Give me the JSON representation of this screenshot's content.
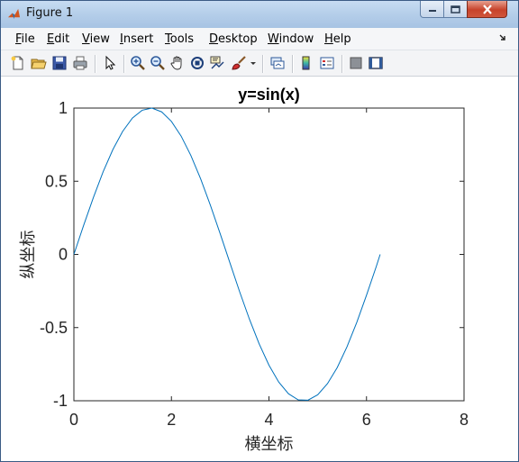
{
  "window": {
    "title": "Figure 1"
  },
  "menu": {
    "file": {
      "u": "F",
      "rest": "ile"
    },
    "edit": {
      "u": "E",
      "rest": "dit"
    },
    "view": {
      "u": "V",
      "rest": "iew"
    },
    "insert": {
      "u": "I",
      "rest": "nsert"
    },
    "tools": {
      "u": "T",
      "rest": "ools"
    },
    "desktop": {
      "u": "D",
      "rest": "esktop"
    },
    "window": {
      "u": "W",
      "rest": "indow"
    },
    "help": {
      "u": "H",
      "rest": "elp"
    }
  },
  "toolbar_icons": [
    "new-figure-icon",
    "open-file-icon",
    "save-icon",
    "print-icon",
    "arrow-pointer-icon",
    "zoom-in-icon",
    "zoom-out-icon",
    "pan-hand-icon",
    "rotate-3d-icon",
    "data-cursor-icon",
    "brush-icon",
    "link-plot-icon",
    "colorbar-icon",
    "legend-icon",
    "hide-plot-tools-icon",
    "show-plot-tools-icon"
  ],
  "colors": {
    "line": "#0072BD",
    "axis": "#262626"
  },
  "chart_data": {
    "type": "line",
    "title": "y=sin(x)",
    "xlabel": "横坐标",
    "ylabel": "纵坐标",
    "xlim": [
      0,
      8
    ],
    "ylim": [
      -1,
      1
    ],
    "xticks": [
      0,
      2,
      4,
      6,
      8
    ],
    "xtick_labels": [
      "0",
      "2",
      "4",
      "6",
      "8"
    ],
    "yticks": [
      -1,
      -0.5,
      0,
      0.5,
      1
    ],
    "ytick_labels": [
      "-1",
      "-0.5",
      "0",
      "0.5",
      "1"
    ],
    "grid": false,
    "series": [
      {
        "x": [
          0,
          0.2,
          0.4,
          0.6,
          0.8,
          1.0,
          1.2,
          1.4,
          1.6,
          1.8,
          2.0,
          2.2,
          2.4,
          2.6,
          2.8,
          3.0,
          3.2,
          3.4,
          3.6,
          3.8,
          4.0,
          4.2,
          4.4,
          4.6,
          4.8,
          5.0,
          5.2,
          5.4,
          5.6,
          5.8,
          6.0,
          6.2,
          6.28
        ],
        "y": [
          0,
          0.199,
          0.389,
          0.565,
          0.717,
          0.841,
          0.932,
          0.985,
          1.0,
          0.974,
          0.909,
          0.808,
          0.675,
          0.516,
          0.335,
          0.141,
          -0.058,
          -0.256,
          -0.443,
          -0.612,
          -0.757,
          -0.872,
          -0.952,
          -0.994,
          -0.996,
          -0.959,
          -0.883,
          -0.773,
          -0.631,
          -0.465,
          -0.279,
          -0.083,
          0
        ]
      }
    ]
  }
}
